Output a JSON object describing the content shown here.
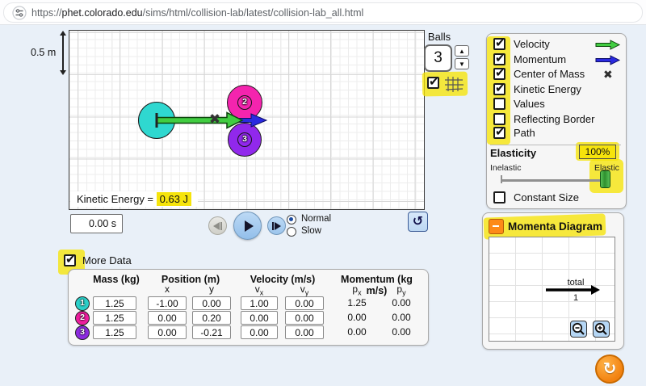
{
  "browser": {
    "url": {
      "scheme": "https://",
      "host": "phet.colorado.edu",
      "path": "/sims/html/collision-lab/latest/collision-lab_all.html"
    }
  },
  "play_area": {
    "scale_label": "0.5 m",
    "kinetic_energy_label": "Kinetic Energy = ",
    "kinetic_energy_value": "0.63 J",
    "ball_numbers": [
      "1",
      "2",
      "3"
    ],
    "center_of_mass_icon": "✖"
  },
  "time_display": {
    "value": "0.00 s"
  },
  "playback": {
    "speed_normal": "Normal",
    "speed_slow": "Slow"
  },
  "balls_spinner": {
    "label": "Balls",
    "value": "3",
    "up_icon": "▲",
    "down_icon": "▼"
  },
  "control_panel": {
    "checkboxes": [
      {
        "label": "Velocity",
        "checked": true,
        "icon": "velocity-arrow-green"
      },
      {
        "label": "Momentum",
        "checked": true,
        "icon": "momentum-arrow-blue"
      },
      {
        "label": "Center of Mass",
        "checked": true,
        "icon": "x-marker"
      },
      {
        "label": "Kinetic Energy",
        "checked": true
      },
      {
        "label": "Values",
        "checked": false
      },
      {
        "label": "Reflecting Border",
        "checked": false
      },
      {
        "label": "Path",
        "checked": true
      }
    ],
    "x_marker_icon": "✖",
    "elasticity": {
      "title": "Elasticity",
      "value": "100%",
      "left_label": "Inelastic",
      "right_label": "Elastic",
      "percent": 100
    },
    "constant_size": {
      "label": "Constant Size",
      "checked": false
    }
  },
  "momenta_diagram": {
    "title": "Momenta Diagram",
    "collapse_state": "collapsed-toggle-minus",
    "total_label": "total",
    "total_value": "1"
  },
  "more_data": {
    "label": "More Data",
    "checked": true
  },
  "data_table": {
    "headers": {
      "mass": "Mass (kg)",
      "position": "Position (m)",
      "velocity": "Velocity (m/s)",
      "momentum": "Momentum (kg m/s)"
    },
    "sub_headers": [
      {
        "main": "x"
      },
      {
        "main": "y"
      },
      {
        "main": "v",
        "sub": "x"
      },
      {
        "main": "v",
        "sub": "y"
      },
      {
        "main": "p",
        "sub": "x"
      },
      {
        "main": "p",
        "sub": "y"
      }
    ],
    "rows": [
      {
        "ball": "1",
        "color": "#2bd0c9",
        "mass": "1.25",
        "x": "-1.00",
        "y": "0.00",
        "vx": "1.00",
        "vy": "0.00",
        "px": "1.25",
        "py": "0.00"
      },
      {
        "ball": "2",
        "color": "#ee1d9e",
        "mass": "1.25",
        "x": "0.00",
        "y": "0.20",
        "vx": "0.00",
        "vy": "0.00",
        "px": "0.00",
        "py": "0.00"
      },
      {
        "ball": "3",
        "color": "#8d2be0",
        "mass": "1.25",
        "x": "0.00",
        "y": "-0.21",
        "vx": "0.00",
        "vy": "0.00",
        "px": "0.00",
        "py": "0.00"
      }
    ]
  },
  "reset_button_icon": "↻",
  "restart_button_icon": "↺",
  "colors": {
    "ball1": "#2fd8d0",
    "ball2": "#f424ae",
    "ball3": "#9128ec",
    "velocity_arrow": "#41cd41",
    "momentum_arrow": "#2a2ae0",
    "highlight_yellow": "#f6e40b",
    "reset_orange": "#f5881c",
    "background": "#e9f0f8"
  }
}
